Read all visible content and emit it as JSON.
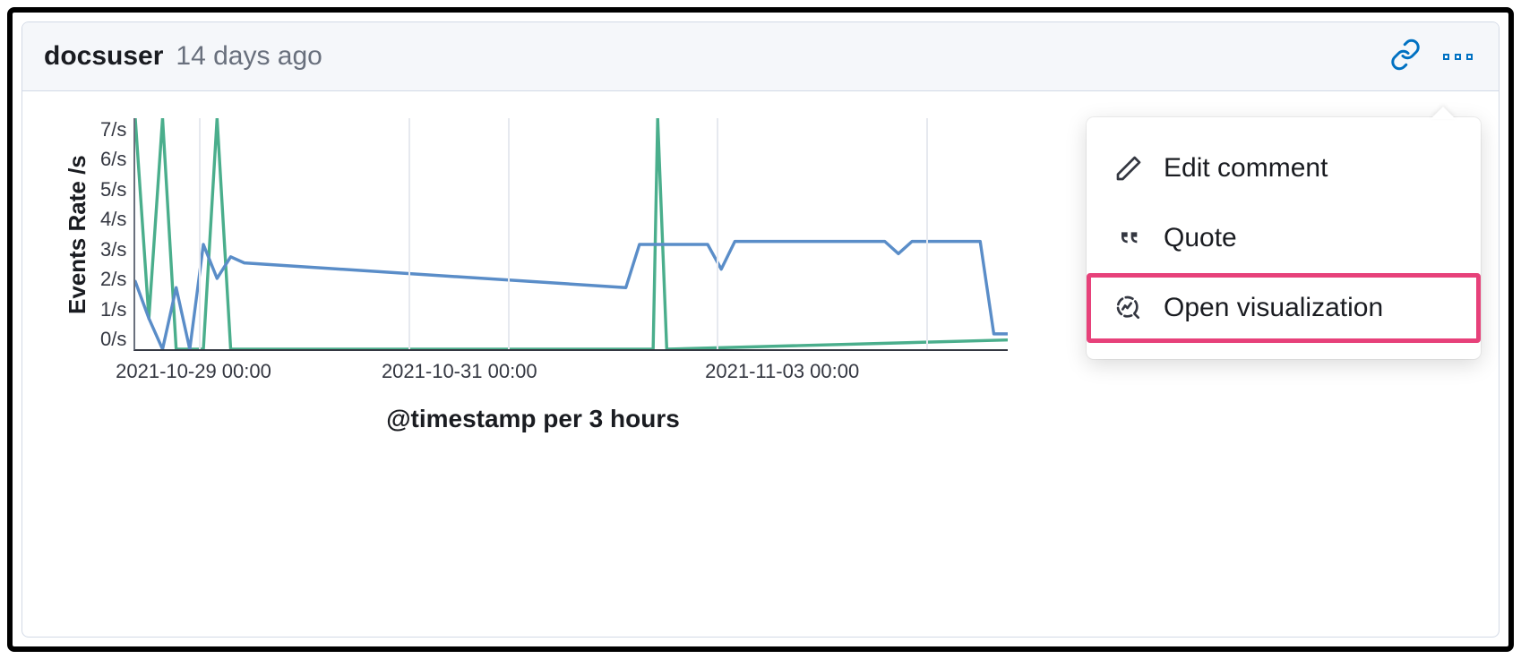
{
  "header": {
    "username": "docsuser",
    "timestamp": "14 days ago"
  },
  "menu": {
    "edit": "Edit comment",
    "quote": "Quote",
    "open_vis": "Open visualization"
  },
  "chart_data": {
    "type": "line",
    "ylabel": "Events Rate /s",
    "xlabel": "@timestamp per 3 hours",
    "yticks": [
      "7/s",
      "6/s",
      "5/s",
      "4/s",
      "3/s",
      "2/s",
      "1/s",
      "0/s"
    ],
    "xticks": [
      "2021-10-29 00:00",
      "2021-10-31 00:00",
      "2021-11-03 00:00"
    ],
    "ylim": [
      0,
      7.5
    ],
    "x_range_hours": [
      0,
      192
    ],
    "series": [
      {
        "name": "green",
        "color": "#4aae8c",
        "points": [
          [
            0,
            7.5
          ],
          [
            3,
            1
          ],
          [
            6,
            7.5
          ],
          [
            9,
            0
          ],
          [
            12,
            0
          ],
          [
            15,
            0
          ],
          [
            18,
            7.5
          ],
          [
            21,
            0
          ],
          [
            24,
            0
          ],
          [
            27,
            0
          ],
          [
            30,
            0
          ],
          [
            33,
            0
          ],
          [
            114,
            0
          ],
          [
            115,
            7.5
          ],
          [
            117,
            0
          ],
          [
            192,
            0.3
          ]
        ]
      },
      {
        "name": "blue",
        "color": "#5a8dc8",
        "points": [
          [
            0,
            2.2
          ],
          [
            3,
            1
          ],
          [
            6,
            0
          ],
          [
            9,
            2
          ],
          [
            12,
            0
          ],
          [
            15,
            3.4
          ],
          [
            18,
            2.3
          ],
          [
            21,
            3
          ],
          [
            24,
            2.8
          ],
          [
            108,
            2
          ],
          [
            111,
            3.4
          ],
          [
            126,
            3.4
          ],
          [
            129,
            2.6
          ],
          [
            132,
            3.5
          ],
          [
            165,
            3.5
          ],
          [
            168,
            3.1
          ],
          [
            171,
            3.5
          ],
          [
            186,
            3.5
          ],
          [
            189,
            0.5
          ],
          [
            192,
            0.5
          ]
        ]
      }
    ],
    "grid_x_hours": [
      14,
      60,
      82,
      128,
      174
    ]
  }
}
